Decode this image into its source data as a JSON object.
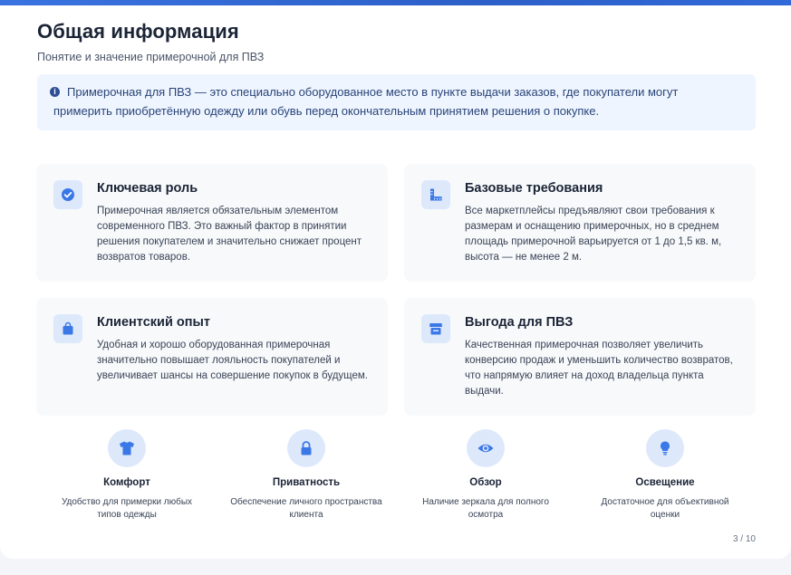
{
  "header": {
    "title": "Общая информация",
    "subtitle": "Понятие и значение примерочной для ПВЗ"
  },
  "info": {
    "icon": "info-icon",
    "text": "Примерочная для ПВЗ — это специально оборудованное место в пункте выдачи заказов, где покупатели могут примерить приобретённую одежду или обувь перед окончательным принятием решения о покупке."
  },
  "cards": [
    {
      "icon": "check-circle-icon",
      "title": "Ключевая роль",
      "text": "Примерочная является обязательным элементом современного ПВЗ. Это важный фактор в принятии решения покупателем и значительно снижает процент возвратов товаров."
    },
    {
      "icon": "ruler-icon",
      "title": "Базовые требования",
      "text": "Все маркетплейсы предъявляют свои требования к размерам и оснащению примерочных, но в среднем площадь примерочной варьируется от 1 до 1,5 кв. м, высота — не менее 2 м."
    },
    {
      "icon": "shopping-bag-icon",
      "title": "Клиентский опыт",
      "text": "Удобная и хорошо оборудованная примерочная значительно повышает лояльность покупателей и увеличивает шансы на совершение покупок в будущем."
    },
    {
      "icon": "store-icon",
      "title": "Выгода для ПВЗ",
      "text": "Качественная примерочная позволяет увеличить конверсию продаж и уменьшить количество возвратов, что напрямую влияет на доход владельца пункта выдачи."
    }
  ],
  "features": [
    {
      "icon": "tshirt-icon",
      "title": "Комфорт",
      "text": "Удобство для примерки любых типов одежды"
    },
    {
      "icon": "lock-icon",
      "title": "Приватность",
      "text": "Обеспечение личного пространства клиента"
    },
    {
      "icon": "eye-icon",
      "title": "Обзор",
      "text": "Наличие зеркала для полного осмотра"
    },
    {
      "icon": "lightbulb-icon",
      "title": "Освещение",
      "text": "Достаточное для объективной оценки"
    }
  ],
  "footer": {
    "page": "3 / 10"
  },
  "colors": {
    "accent": "#3a73e0",
    "icon_bg": "#dde9fb",
    "icon_fg": "#3b78e7",
    "info_bg": "#eef5ff"
  }
}
